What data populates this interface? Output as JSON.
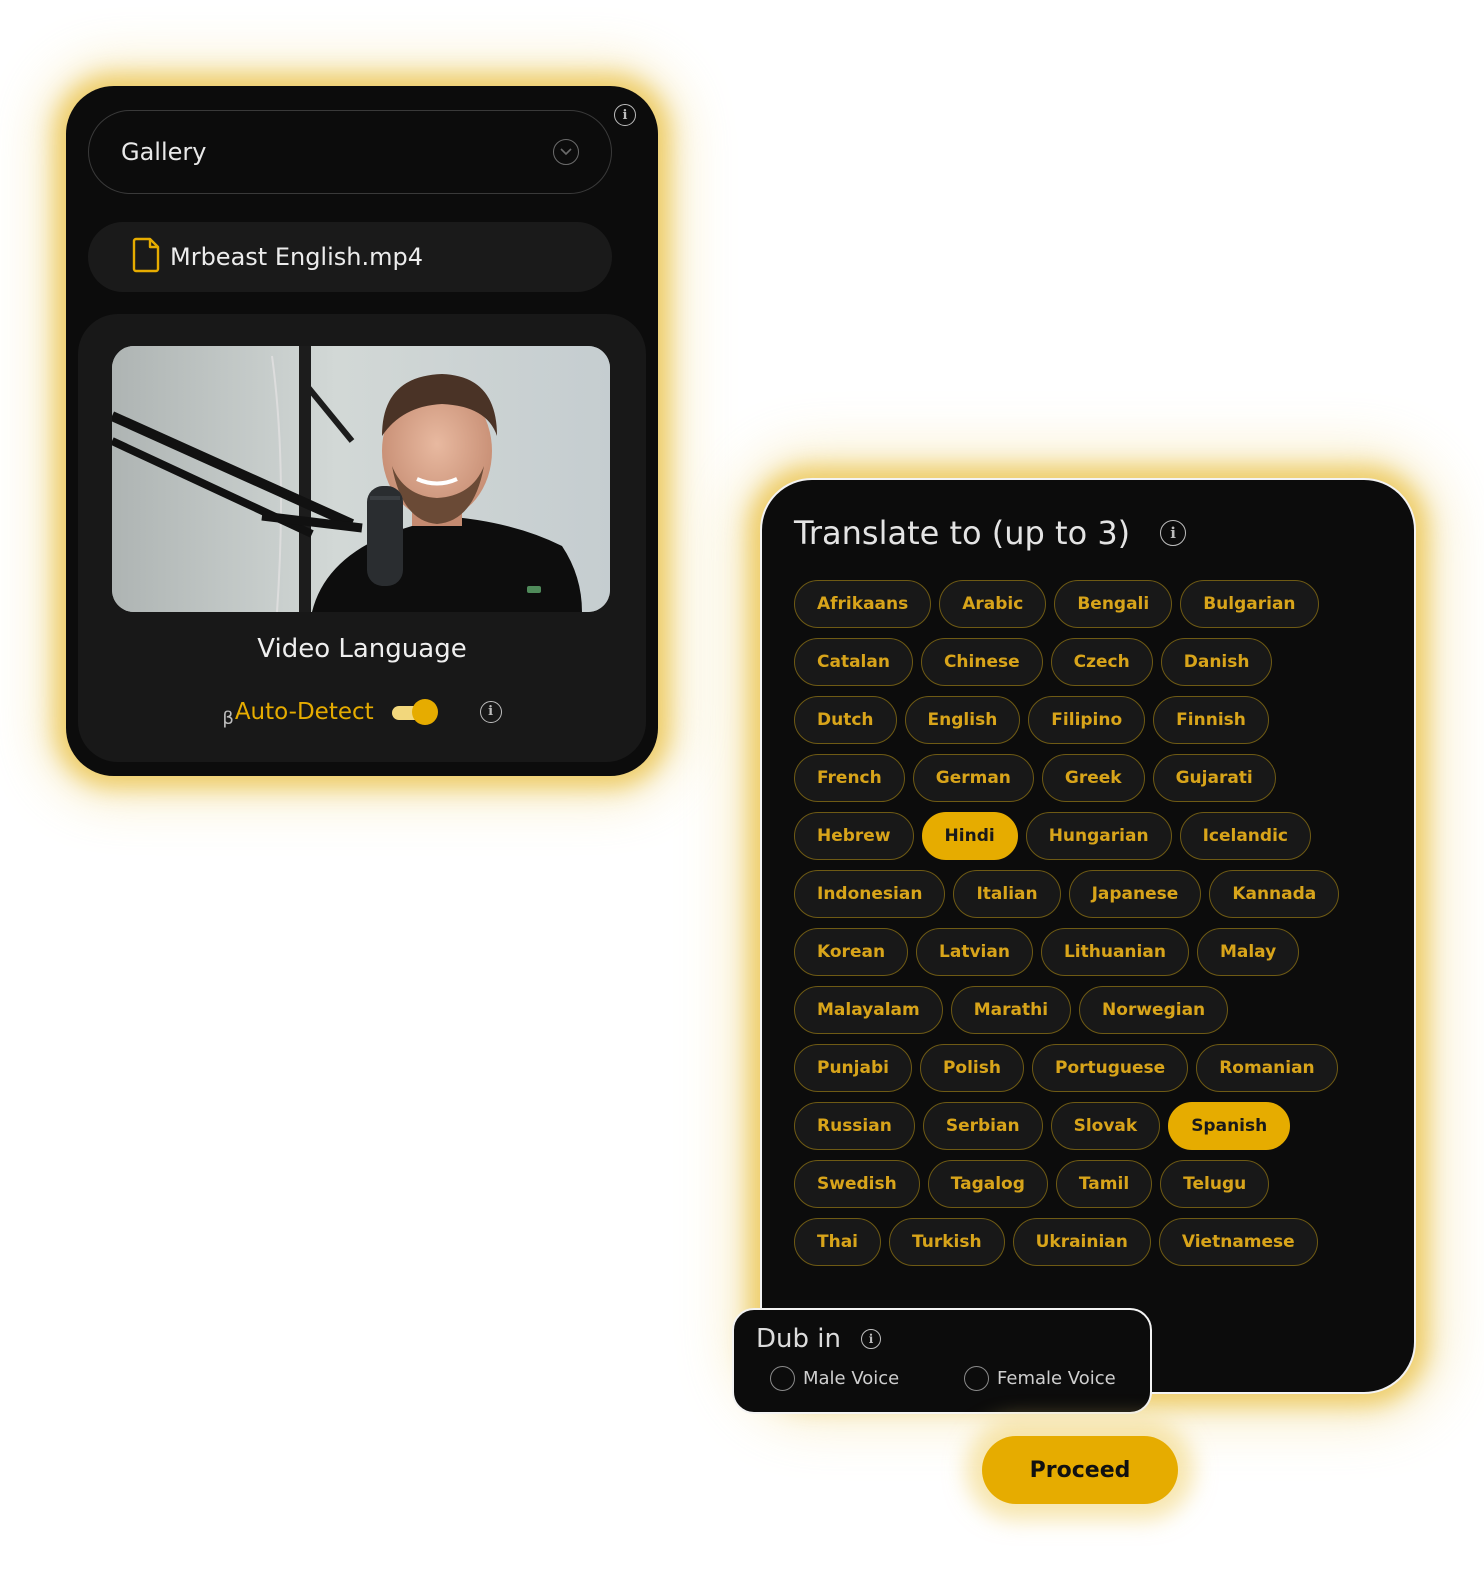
{
  "source": {
    "source_select": {
      "value": "Gallery",
      "icon": "chevron-down-circle-icon"
    },
    "file": {
      "name": "Mrbeast English.mp4",
      "icon": "file-icon",
      "icon_color": "#e6ac00"
    },
    "preview": {
      "description": "Video thumbnail of a man speaking into a podcast microphone"
    },
    "video_language": {
      "title": "Video Language",
      "beta_mark": "β",
      "auto_detect_label": "Auto-Detect",
      "auto_detect_on": true
    }
  },
  "translate": {
    "title": "Translate to (up to 3)",
    "max_selections": 3,
    "languages": [
      {
        "label": "Afrikaans",
        "selected": false
      },
      {
        "label": "Arabic",
        "selected": false
      },
      {
        "label": "Bengali",
        "selected": false
      },
      {
        "label": "Bulgarian",
        "selected": false
      },
      {
        "label": "Catalan",
        "selected": false
      },
      {
        "label": "Chinese",
        "selected": false
      },
      {
        "label": "Czech",
        "selected": false
      },
      {
        "label": "Danish",
        "selected": false
      },
      {
        "label": "Dutch",
        "selected": false
      },
      {
        "label": "English",
        "selected": false
      },
      {
        "label": "Filipino",
        "selected": false
      },
      {
        "label": "Finnish",
        "selected": false
      },
      {
        "label": "French",
        "selected": false
      },
      {
        "label": "German",
        "selected": false
      },
      {
        "label": "Greek",
        "selected": false
      },
      {
        "label": "Gujarati",
        "selected": false
      },
      {
        "label": "Hebrew",
        "selected": false
      },
      {
        "label": "Hindi",
        "selected": true
      },
      {
        "label": "Hungarian",
        "selected": false
      },
      {
        "label": "Icelandic",
        "selected": false
      },
      {
        "label": "Indonesian",
        "selected": false
      },
      {
        "label": "Italian",
        "selected": false
      },
      {
        "label": "Japanese",
        "selected": false
      },
      {
        "label": "Kannada",
        "selected": false
      },
      {
        "label": "Korean",
        "selected": false
      },
      {
        "label": "Latvian",
        "selected": false
      },
      {
        "label": "Lithuanian",
        "selected": false
      },
      {
        "label": "Malay",
        "selected": false
      },
      {
        "label": "Malayalam",
        "selected": false
      },
      {
        "label": "Marathi",
        "selected": false
      },
      {
        "label": "Norwegian",
        "selected": false
      },
      {
        "label": "Punjabi",
        "selected": false
      },
      {
        "label": "Polish",
        "selected": false
      },
      {
        "label": "Portuguese",
        "selected": false
      },
      {
        "label": "Romanian",
        "selected": false
      },
      {
        "label": "Russian",
        "selected": false
      },
      {
        "label": "Serbian",
        "selected": false
      },
      {
        "label": "Slovak",
        "selected": false
      },
      {
        "label": "Spanish",
        "selected": true
      },
      {
        "label": "Swedish",
        "selected": false
      },
      {
        "label": "Tagalog",
        "selected": false
      },
      {
        "label": "Tamil",
        "selected": false
      },
      {
        "label": "Telugu",
        "selected": false
      },
      {
        "label": "Thai",
        "selected": false
      },
      {
        "label": "Turkish",
        "selected": false
      },
      {
        "label": "Ukrainian",
        "selected": false
      },
      {
        "label": "Vietnamese",
        "selected": false
      }
    ]
  },
  "dub": {
    "title": "Dub in",
    "options": [
      {
        "label": "Male Voice",
        "checked": false
      },
      {
        "label": "Female Voice",
        "checked": false
      }
    ]
  },
  "actions": {
    "proceed_label": "Proceed"
  },
  "colors": {
    "accent": "#e6ac00",
    "panel_bg": "#0c0c0c",
    "chip_bg": "#181818",
    "glow": "#ecc85a"
  }
}
